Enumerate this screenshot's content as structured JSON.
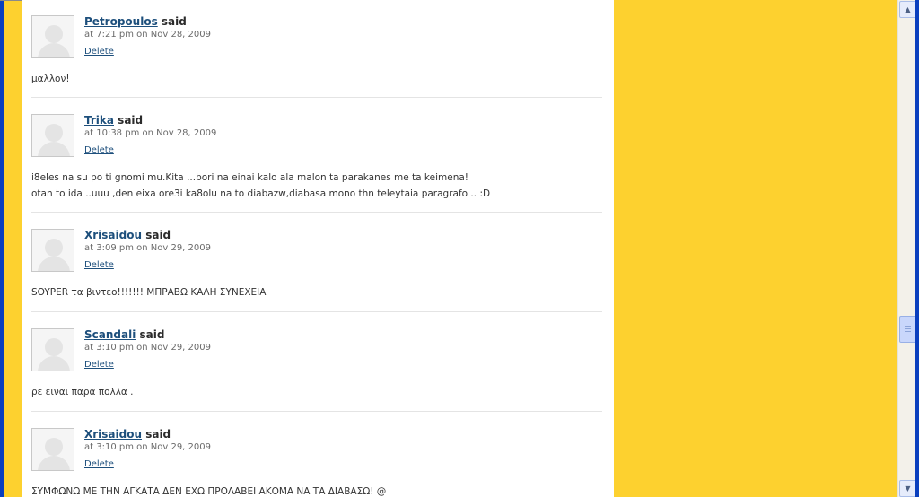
{
  "comments": [
    {
      "author": "Petropoulos",
      "said": "said",
      "date": "at 7:21 pm on Nov 28, 2009",
      "delete_label": "Delete",
      "lines": [
        "μαλλον!"
      ]
    },
    {
      "author": "Trika",
      "said": "said",
      "date": "at 10:38 pm on Nov 28, 2009",
      "delete_label": "Delete",
      "lines": [
        "i8eles na su po ti gnomi mu.Kita ...bori na einai kalo ala malon ta parakanes me ta keimena!",
        "otan to ida ..uuu ,den eixa ore3i ka8olu na to diabazw,diabasa mono thn teleytaia paragrafo .. :D"
      ]
    },
    {
      "author": "Xrisaidou",
      "said": "said",
      "date": "at 3:09 pm on Nov 29, 2009",
      "delete_label": "Delete",
      "lines": [
        "SOYPER τα βιντεο!!!!!!! ΜΠΡΑΒΩ ΚΑΛΗ ΣΥΝΕΧΕΙΑ"
      ]
    },
    {
      "author": "Scandali",
      "said": "said",
      "date": "at 3:10 pm on Nov 29, 2009",
      "delete_label": "Delete",
      "lines": [
        "ρε ειναι παρα πολλα ."
      ]
    },
    {
      "author": "Xrisaidou",
      "said": "said",
      "date": "at 3:10 pm on Nov 29, 2009",
      "delete_label": "Delete",
      "lines": [
        "ΣΥΜΦΩΝΩ ΜΕ ΤΗΝ ΑΓΚΑΤΑ ΔΕΝ ΕΧΩ ΠΡΟΛΑΒΕΙ ΑΚΟΜΑ ΝΑ ΤΑ ΔΙΑΒΑΣΩ! @"
      ]
    }
  ],
  "icons": {
    "scroll_up": "scroll-up-arrow-icon",
    "scroll_down": "scroll-down-arrow-icon",
    "avatar": "default-avatar-icon"
  },
  "colors": {
    "page_background": "#fdd12f",
    "window_frame": "#0a3fbe",
    "content_background": "#ffffff",
    "link": "#1d4f7c"
  }
}
